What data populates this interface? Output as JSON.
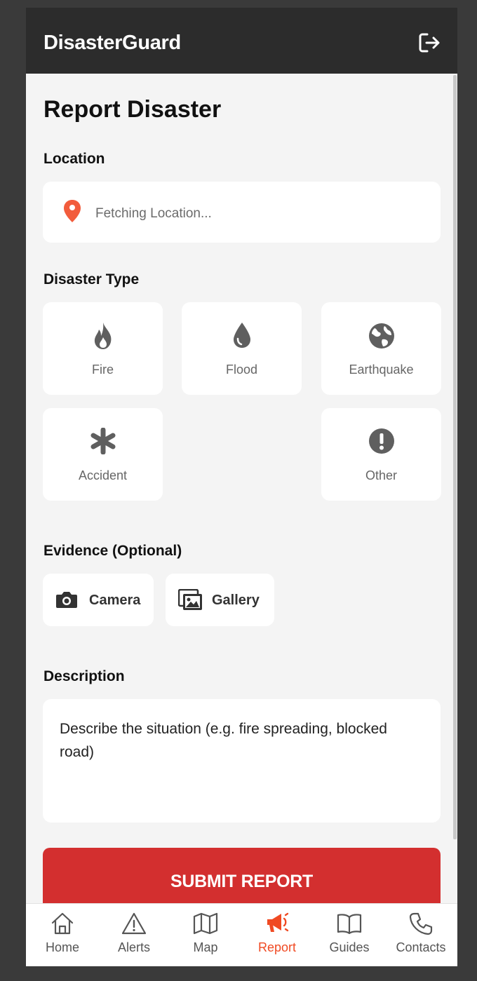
{
  "header": {
    "app_title": "DisasterGuard",
    "logout_icon": "logout-icon"
  },
  "page": {
    "title": "Report Disaster"
  },
  "location": {
    "label": "Location",
    "status": "Fetching Location...",
    "icon": "map-pin-icon"
  },
  "disaster_type": {
    "label": "Disaster Type",
    "options": [
      {
        "label": "Fire",
        "icon": "fire-icon"
      },
      {
        "label": "Flood",
        "icon": "water-drop-icon"
      },
      {
        "label": "Earthquake",
        "icon": "globe-icon"
      },
      {
        "label": "Accident",
        "icon": "asterisk-icon"
      },
      {
        "label": "Other",
        "icon": "exclamation-icon"
      }
    ]
  },
  "evidence": {
    "label": "Evidence (Optional)",
    "camera_label": "Camera",
    "gallery_label": "Gallery"
  },
  "description": {
    "label": "Description",
    "placeholder": "Describe the situation (e.g. fire spreading, blocked road)"
  },
  "submit": {
    "label": "SUBMIT REPORT"
  },
  "nav": {
    "items": [
      {
        "label": "Home",
        "icon": "home-icon"
      },
      {
        "label": "Alerts",
        "icon": "alert-triangle-icon"
      },
      {
        "label": "Map",
        "icon": "map-icon"
      },
      {
        "label": "Report",
        "icon": "megaphone-icon",
        "active": true
      },
      {
        "label": "Guides",
        "icon": "book-icon"
      },
      {
        "label": "Contacts",
        "icon": "phone-icon"
      }
    ]
  },
  "colors": {
    "accent": "#f04a23",
    "submit": "#d32f2f",
    "header": "#2c2c2c",
    "pin": "#f25c3c"
  }
}
